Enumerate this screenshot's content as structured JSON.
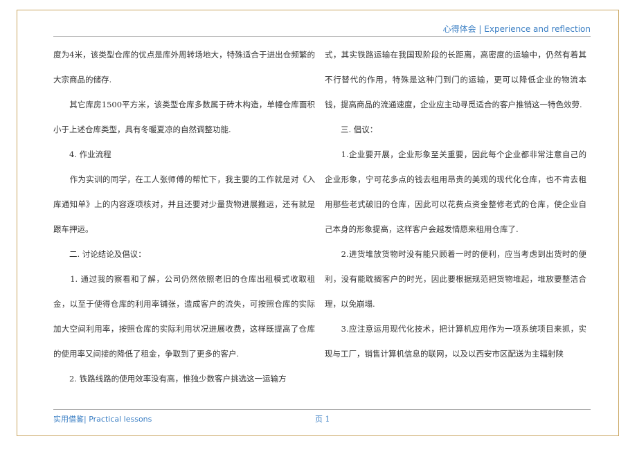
{
  "header": {
    "text": "心得体会 | Experience and reflection"
  },
  "left_column": {
    "paragraphs": [
      "度为4米，该类型仓库的优点是库外周转场地大，特殊适合于进出仓频繁的大宗商品的储存.",
      "　　其它库房1500平方米，该类型仓库多数属于砖木构造，单幢仓库面积小于上述仓库类型，具有冬暖夏凉的自然调整功能.",
      "　　4. 作业流程",
      "　　作为实训的同学，在工人张师傅的帮忙下，我主要的工作就是对《入库通知单》上的内容逐项核对，并且还要对少量货物进展搬运，还有就是跟车押运。",
      "　　二. 讨论结论及倡议：",
      "　　1. 通过我的察看和了解，公司仍然依照老旧的仓库出租模式收取租金，以至于使得仓库的利用率铺张，造成客户的流失，可按照仓库的实际加大空间利用率，按照仓库的实际利用状况进展收费，这样既提高了仓库的使用率又间接的降低了租金，争取到了更多的客户.",
      "　　2. 铁路线路的使用效率没有高，惟独少数客户挑选这一运输方"
    ]
  },
  "right_column": {
    "paragraphs": [
      "式，其实铁路运输在我国现阶段的长距离，高密度的运输中，仍然有着其不行替代的作用，特殊是这种门到门的运输，更可以降低企业的物流本钱，提高商品的流通速度，企业应主动寻觅适合的客户推销这一特色效劳.",
      "　　三. 倡议：",
      "　　1.企业要开展，企业形象至关重要，因此每个企业都非常注意自己的企业形象，宁可花多点的钱去租用昂贵的美观的现代化仓库，也不肯去租用那些老式破旧的仓库，因此可以花费点资金整修老式的仓库，使企业自己本身的形象提高，这样客户会越发情愿来租用仓库了.",
      "　　2.进货堆放货物时没有能只顾着一时的便利，应当考虑到出货时的便利，没有能耽搁客户的时光，因此要根据规范把货物堆起，堆放要整洁合理，以免崩塌.",
      "　　3.应注意运用现代化技术，把计算机应用作为一项系统项目来抓，实现与工厂，销售计算机信息的联网，以及以西安市区配送为主辐射陕"
    ]
  },
  "footer": {
    "left_text": "实用借鉴| Practical lessons",
    "page_label": "页 1"
  }
}
